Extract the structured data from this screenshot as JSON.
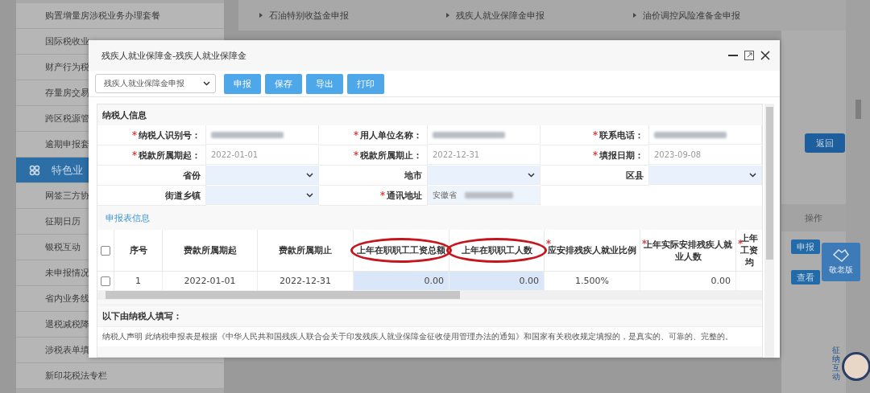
{
  "sidebar": [
    {
      "label": "购置增量房涉税业务办理套餐",
      "selected": false
    },
    {
      "label": "国际税收业",
      "selected": false
    },
    {
      "label": "财产行为税",
      "selected": false
    },
    {
      "label": "存量房交易",
      "selected": false
    },
    {
      "label": "跨区税源管",
      "selected": false
    },
    {
      "label": "逾期申报套",
      "selected": false
    },
    {
      "label": "特色业",
      "selected": true
    },
    {
      "label": "网签三方协",
      "selected": false
    },
    {
      "label": "征期日历",
      "selected": false
    },
    {
      "label": "银税互动",
      "selected": false
    },
    {
      "label": "未申报情况",
      "selected": false
    },
    {
      "label": "省内业务线",
      "selected": false
    },
    {
      "label": "退税减税降",
      "selected": false
    },
    {
      "label": "涉税表单填",
      "selected": false
    },
    {
      "label": "新印花税法专栏",
      "selected": false
    }
  ],
  "links": [
    "石油特别收益金申报",
    "残疾人就业保障金申报",
    "油价调控风险准备金申报"
  ],
  "return_button": "返回",
  "operations": {
    "header": "操作",
    "buttons": [
      "申报",
      "查看"
    ]
  },
  "elder_mode": "敬老版",
  "assistant": "征纳互动",
  "dialog": {
    "title": "残疾人就业保障金-残疾人就业保障金",
    "form_select": "残疾人就业保障金申报",
    "toolbar": [
      "申报",
      "保存",
      "导出",
      "打印"
    ],
    "info_title": "纳税人信息",
    "form_rows": [
      [
        {
          "label": "纳税人识别号：",
          "required": true,
          "kind": "redacted"
        },
        {
          "label": "用人单位名称：",
          "required": true,
          "kind": "redacted"
        },
        {
          "label": "联系电话：",
          "required": true,
          "kind": "redacted"
        }
      ],
      [
        {
          "label": "税款所属期起：",
          "required": true,
          "kind": "static",
          "value": "2022-01-01"
        },
        {
          "label": "税款所属期止：",
          "required": true,
          "kind": "static",
          "value": "2022-12-31"
        },
        {
          "label": "填报日期：",
          "required": true,
          "kind": "static",
          "value": "2023-09-08"
        }
      ],
      [
        {
          "label": "省份",
          "required": false,
          "kind": "select"
        },
        {
          "label": "地市",
          "required": false,
          "kind": "select"
        },
        {
          "label": "区县",
          "required": false,
          "kind": "select"
        }
      ],
      [
        {
          "label": "街道乡镇",
          "required": false,
          "kind": "select"
        },
        {
          "label": "通讯地址",
          "required": true,
          "kind": "input",
          "value": "安徽省"
        }
      ]
    ],
    "table_title": "申报表信息",
    "header_checked": false,
    "columns": [
      {
        "label": "序号",
        "required": false,
        "annotated": false
      },
      {
        "label": "费款所属期起",
        "required": false,
        "annotated": false
      },
      {
        "label": "费款所属期止",
        "required": false,
        "annotated": false
      },
      {
        "label": "上年在职职工工资总额",
        "required": false,
        "annotated": true
      },
      {
        "label": "上年在职职工人数",
        "required": false,
        "annotated": true
      },
      {
        "label": "应安排残疾人就业比例",
        "required": true,
        "annotated": false
      },
      {
        "label": "上年实际安排残疾人就业人数",
        "required": true,
        "annotated": false
      },
      {
        "label": "上年工资均",
        "required": true,
        "annotated": false
      }
    ],
    "rows": [
      {
        "checked": false,
        "cells": [
          {
            "text": "1",
            "editable": false
          },
          {
            "text": "2022-01-01",
            "editable": false
          },
          {
            "text": "2022-12-31",
            "editable": false
          },
          {
            "text": "0.00",
            "editable": true
          },
          {
            "text": "0.00",
            "editable": true
          },
          {
            "text": "1.500%",
            "editable": false
          },
          {
            "text": "0.00",
            "editable": false
          }
        ]
      }
    ],
    "fill_title": "以下由纳税人填写：",
    "declaration": "纳税人声明 此纳税申报表是根据《中华人民共和国残疾人联合会关于印发残疾人就业保障金征收使用管理办法的通知》和国家有关税收规定填报的，是真实的、可靠的、完整的。"
  }
}
